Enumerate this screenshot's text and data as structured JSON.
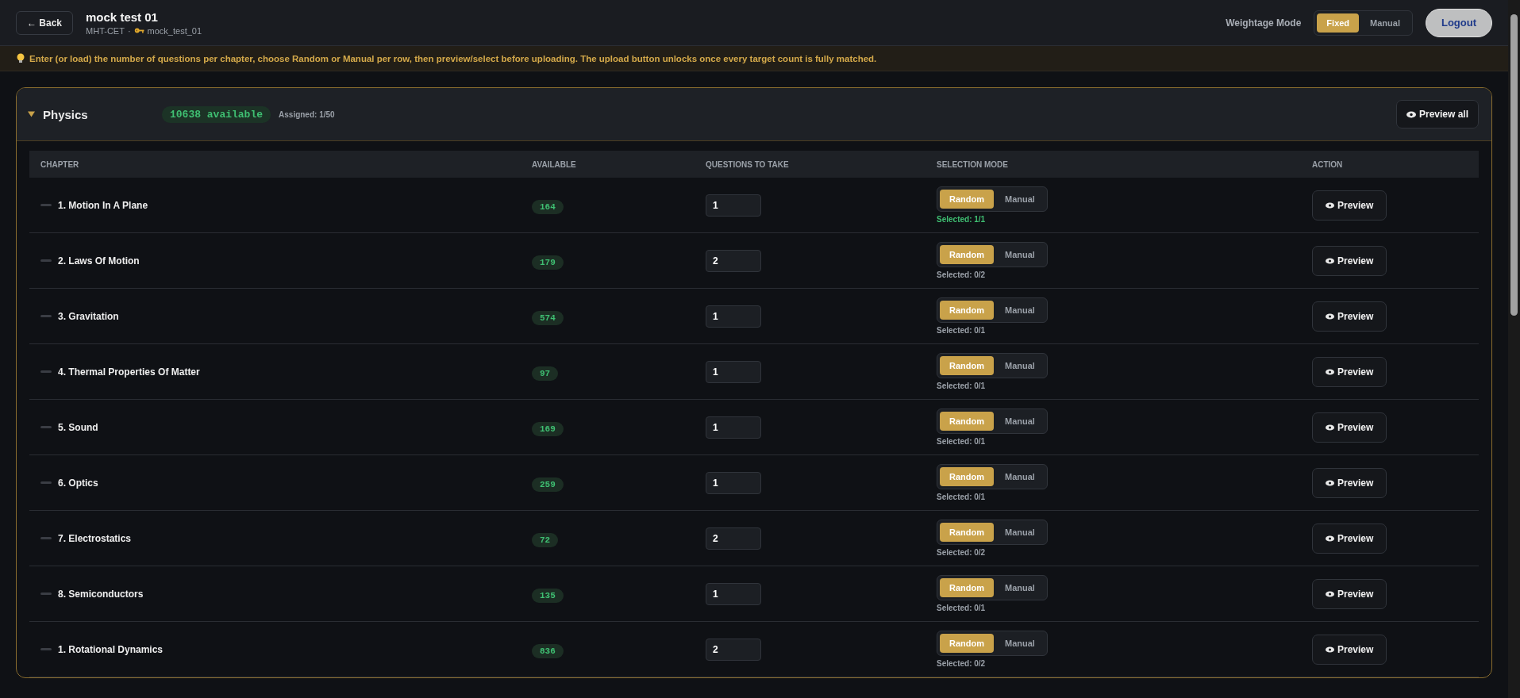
{
  "header": {
    "back": "← Back",
    "title": "mock test 01",
    "exam": "MHT-CET",
    "separator": "·",
    "code": "mock_test_01",
    "weightage_label": "Weightage Mode",
    "weightage_modes": [
      {
        "label": "Fixed",
        "selected": true
      },
      {
        "label": "Manual",
        "selected": false
      }
    ],
    "logout": "Logout"
  },
  "banner": "Enter (or load) the number of questions per chapter, choose Random or Manual per row, then preview/select before uploading. The upload button unlocks once every target count is fully matched.",
  "section": {
    "name": "Physics",
    "expanded": true,
    "available": "10638 available",
    "assigned": "Assigned: 1/50",
    "preview_all": "Preview all",
    "columns": [
      "CHAPTER",
      "AVAILABLE",
      "QUESTIONS TO TAKE",
      "SELECTION MODE",
      "ACTION"
    ],
    "rows": [
      {
        "chapter": "1. Motion In A Plane",
        "available": "164",
        "take": "1",
        "modes": [
          {
            "label": "Random",
            "selected": true
          },
          {
            "label": "Manual",
            "selected": false
          }
        ],
        "selected_text": "Selected: 1/1",
        "complete": true,
        "action": "Preview"
      },
      {
        "chapter": "2. Laws Of Motion",
        "available": "179",
        "take": "2",
        "modes": [
          {
            "label": "Random",
            "selected": true
          },
          {
            "label": "Manual",
            "selected": false
          }
        ],
        "selected_text": "Selected: 0/2",
        "complete": false,
        "action": "Preview"
      },
      {
        "chapter": "3. Gravitation",
        "available": "574",
        "take": "1",
        "modes": [
          {
            "label": "Random",
            "selected": true
          },
          {
            "label": "Manual",
            "selected": false
          }
        ],
        "selected_text": "Selected: 0/1",
        "complete": false,
        "action": "Preview"
      },
      {
        "chapter": "4. Thermal Properties Of Matter",
        "available": "97",
        "take": "1",
        "modes": [
          {
            "label": "Random",
            "selected": true
          },
          {
            "label": "Manual",
            "selected": false
          }
        ],
        "selected_text": "Selected: 0/1",
        "complete": false,
        "action": "Preview"
      },
      {
        "chapter": "5. Sound",
        "available": "169",
        "take": "1",
        "modes": [
          {
            "label": "Random",
            "selected": true
          },
          {
            "label": "Manual",
            "selected": false
          }
        ],
        "selected_text": "Selected: 0/1",
        "complete": false,
        "action": "Preview"
      },
      {
        "chapter": "6. Optics",
        "available": "259",
        "take": "1",
        "modes": [
          {
            "label": "Random",
            "selected": true
          },
          {
            "label": "Manual",
            "selected": false
          }
        ],
        "selected_text": "Selected: 0/1",
        "complete": false,
        "action": "Preview"
      },
      {
        "chapter": "7. Electrostatics",
        "available": "72",
        "take": "2",
        "modes": [
          {
            "label": "Random",
            "selected": true
          },
          {
            "label": "Manual",
            "selected": false
          }
        ],
        "selected_text": "Selected: 0/2",
        "complete": false,
        "action": "Preview"
      },
      {
        "chapter": "8. Semiconductors",
        "available": "135",
        "take": "1",
        "modes": [
          {
            "label": "Random",
            "selected": true
          },
          {
            "label": "Manual",
            "selected": false
          }
        ],
        "selected_text": "Selected: 0/1",
        "complete": false,
        "action": "Preview"
      },
      {
        "chapter": "1. Rotational Dynamics",
        "available": "836",
        "take": "2",
        "modes": [
          {
            "label": "Random",
            "selected": true
          },
          {
            "label": "Manual",
            "selected": false
          }
        ],
        "selected_text": "Selected: 0/2",
        "complete": false,
        "action": "Preview"
      }
    ]
  }
}
